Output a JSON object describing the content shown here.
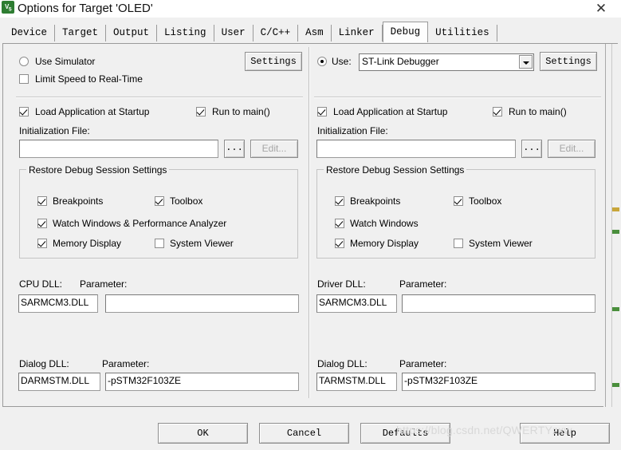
{
  "window": {
    "title": "Options for Target 'OLED'",
    "app_icon": "uvision-v5-icon",
    "close_label": "✕"
  },
  "tabs": [
    {
      "label": "Device",
      "active": false
    },
    {
      "label": "Target",
      "active": false
    },
    {
      "label": "Output",
      "active": false
    },
    {
      "label": "Listing",
      "active": false
    },
    {
      "label": "User",
      "active": false
    },
    {
      "label": "C/C++",
      "active": false
    },
    {
      "label": "Asm",
      "active": false
    },
    {
      "label": "Linker",
      "active": false
    },
    {
      "label": "Debug",
      "active": true
    },
    {
      "label": "Utilities",
      "active": false
    }
  ],
  "left_panel": {
    "simulator_radio": {
      "label": "Use Simulator",
      "checked": false
    },
    "limit_speed": {
      "label": "Limit Speed to Real-Time",
      "checked": false
    },
    "settings_button": "Settings",
    "load_app": {
      "label": "Load Application at Startup",
      "checked": true
    },
    "run_to_main": {
      "label": "Run to main()",
      "checked": true
    },
    "init_file_label": "Initialization File:",
    "init_file_value": "",
    "browse_button": "...",
    "edit_button": "Edit...",
    "restore_group_title": "Restore Debug Session Settings",
    "restore": [
      {
        "label": "Breakpoints",
        "checked": true
      },
      {
        "label": "Toolbox",
        "checked": true
      },
      {
        "label": "Watch Windows & Performance Analyzer",
        "checked": true
      },
      {
        "label": "Memory Display",
        "checked": true
      },
      {
        "label": "System Viewer",
        "checked": false
      }
    ],
    "cpu_dll_label": "CPU DLL:",
    "cpu_dll_value": "SARMCM3.DLL",
    "cpu_param_label": "Parameter:",
    "cpu_param_value": "",
    "dialog_dll_label": "Dialog DLL:",
    "dialog_dll_value": "DARMSTM.DLL",
    "dialog_param_label": "Parameter:",
    "dialog_param_value": "-pSTM32F103ZE"
  },
  "right_panel": {
    "use_radio": {
      "label": "Use:",
      "checked": true
    },
    "debugger_select": "ST-Link Debugger",
    "settings_button": "Settings",
    "load_app": {
      "label": "Load Application at Startup",
      "checked": true
    },
    "run_to_main": {
      "label": "Run to main()",
      "checked": true
    },
    "init_file_label": "Initialization File:",
    "init_file_value": "",
    "browse_button": "...",
    "edit_button": "Edit...",
    "restore_group_title": "Restore Debug Session Settings",
    "restore": [
      {
        "label": "Breakpoints",
        "checked": true
      },
      {
        "label": "Toolbox",
        "checked": true
      },
      {
        "label": "Watch Windows",
        "checked": true
      },
      {
        "label": "Memory Display",
        "checked": true
      },
      {
        "label": "System Viewer",
        "checked": false
      }
    ],
    "driver_dll_label": "Driver DLL:",
    "driver_dll_value": "SARMCM3.DLL",
    "driver_param_label": "Parameter:",
    "driver_param_value": "",
    "dialog_dll_label": "Dialog DLL:",
    "dialog_dll_value": "TARMSTM.DLL",
    "dialog_param_label": "Parameter:",
    "dialog_param_value": "-pSTM32F103ZE"
  },
  "footer": {
    "ok": "OK",
    "cancel": "Cancel",
    "defaults": "Defaults",
    "help": "Help"
  },
  "watermark": "https://blog.csdn.net/QWERTYzxw",
  "colors": {
    "dialog_bg": "#f0f0f0",
    "field_bg": "#ffffff",
    "border": "#9a9a9a",
    "accent_green": "#2e7d32",
    "watermark": "#d8d8d8"
  }
}
